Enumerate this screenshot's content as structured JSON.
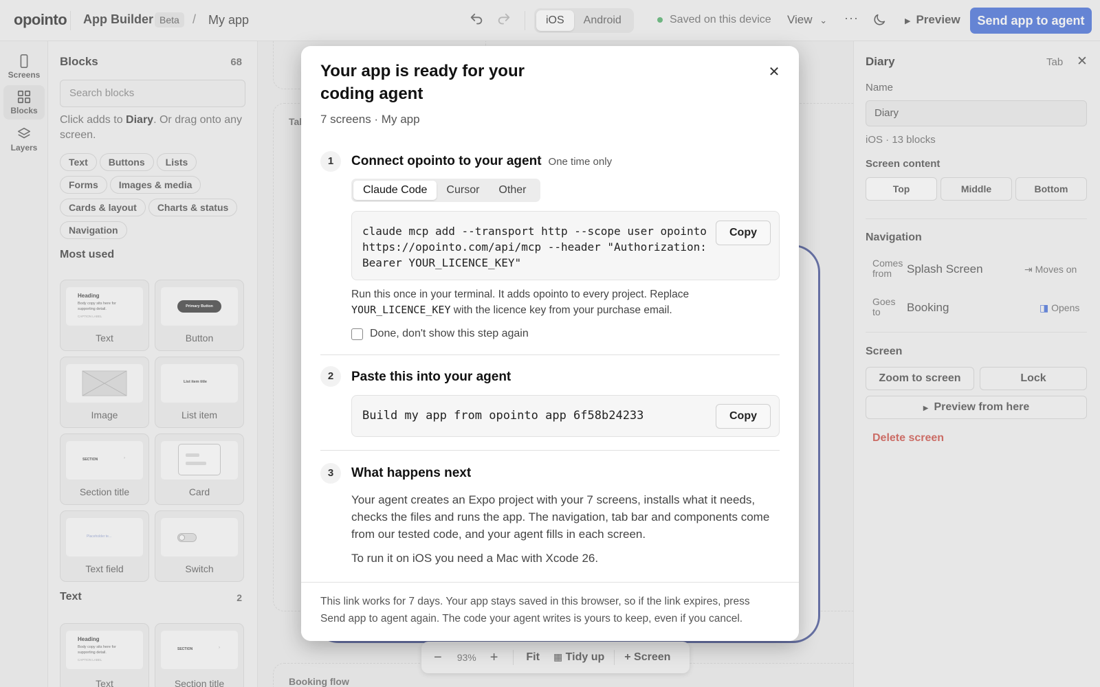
{
  "topbar": {
    "logo": "opointo",
    "app_builder": "App Builder",
    "beta": "Beta",
    "separator": "/",
    "app_name": "My app",
    "platforms": [
      "iOS",
      "Android"
    ],
    "active_platform": "iOS",
    "saved_status": "Saved on this device",
    "view_label": "View",
    "more_label": "···",
    "preview_label": "Preview",
    "send_label": "Send app to agent",
    "accent_color": "#2c5bd6"
  },
  "rail": {
    "items": [
      {
        "label": "Screens",
        "icon": "phone-icon"
      },
      {
        "label": "Blocks",
        "icon": "grid-icon"
      },
      {
        "label": "Layers",
        "icon": "layers-icon"
      }
    ],
    "active": "Blocks"
  },
  "blocks_panel": {
    "title": "Blocks",
    "count": "68",
    "search_placeholder": "Search blocks",
    "hint_prefix": "Click adds to ",
    "hint_target": "Diary",
    "hint_suffix": ". Or drag onto any screen.",
    "chips": [
      "Text",
      "Buttons",
      "Lists",
      "Forms",
      "Images & media",
      "Cards & layout",
      "Charts & status",
      "Navigation"
    ],
    "most_used_title": "Most used",
    "most_used": [
      "Text",
      "Button",
      "Image",
      "List item",
      "Section title",
      "Card",
      "Text field",
      "Switch"
    ],
    "text_section_title": "Text",
    "text_section_count": "2",
    "text_section": [
      "Text",
      "Section title"
    ],
    "thumb_heading": "Heading",
    "thumb_body": "Body copy sits here for supporting detail.",
    "thumb_caption": "CAPTION LABEL",
    "thumb_button": "Primary Button",
    "thumb_list": "List item title",
    "thumb_section": "SECTION",
    "thumb_placeholder": "Placeholder te..."
  },
  "canvas": {
    "frame_label_1": "Tab",
    "frame_label_2": "Booking flow",
    "zoom": {
      "zoom_level": "93%",
      "fit_label": "Fit",
      "tidy_label": "Tidy up",
      "screen_label": "Screen"
    }
  },
  "right_panel": {
    "title": "Diary",
    "type_label": "Tab",
    "name_label": "Name",
    "name_value": "Diary",
    "meta": "iOS · 13 blocks",
    "screen_content_label": "Screen content",
    "content_buttons": [
      "Top",
      "Middle",
      "Bottom"
    ],
    "navigation_label": "Navigation",
    "comes_from_label": "Comes from",
    "comes_from_value": "Splash Screen",
    "comes_from_action": "Moves on",
    "goes_to_label": "Goes to",
    "goes_to_value": "Booking",
    "goes_to_action": "Opens",
    "screen_label": "Screen",
    "zoom_to_screen": "Zoom to screen",
    "lock": "Lock",
    "preview_from_here": "Preview from here",
    "delete_screen": "Delete screen",
    "delete_color": "#c8362c"
  },
  "modal": {
    "title": "Your app is ready for your coding agent",
    "subtitle": "7 screens · My app",
    "step1": {
      "num": "1",
      "title": "Connect opointo to your agent",
      "note": "One time only",
      "tabs": [
        "Claude Code",
        "Cursor",
        "Other"
      ],
      "active_tab": "Claude Code",
      "code": "claude mcp add --transport http --scope user opointo\nhttps://opointo.com/api/mcp --header \"Authorization:\nBearer YOUR_LICENCE_KEY\"",
      "copy": "Copy",
      "help_a": "Run this once in your terminal. It adds opointo to every project. Replace ",
      "help_code": "YOUR_LICENCE_KEY",
      "help_b": " with the licence key from your purchase email.",
      "checkbox": "Done, don't show this step again"
    },
    "step2": {
      "num": "2",
      "title": "Paste this into your agent",
      "code": "Build my app from opointo app 6f58b24233",
      "copy": "Copy"
    },
    "step3": {
      "num": "3",
      "title": "What happens next",
      "body": "Your agent creates an Expo project with your 7 screens, installs what it needs, checks the files and runs the app. The navigation, tab bar and components come from our tested code, and your agent fills in each screen.",
      "note": "To run it on iOS you need a Mac with Xcode 26."
    },
    "footer": "This link works for 7 days. Your app stays saved in this browser, so if the link expires, press Send app to agent again. The code your agent writes is yours to keep, even if you cancel."
  }
}
